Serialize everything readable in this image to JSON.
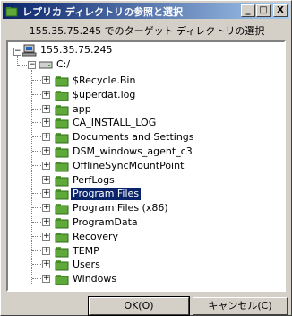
{
  "window": {
    "title": "レプリカ ディレクトリの参照と選択",
    "minimize_label": "_",
    "maximize_label": "□",
    "close_label": "X"
  },
  "subtitle": "155.35.75.245 でのターゲット ディレクトリの選択",
  "tree": {
    "host": "155.35.75.245",
    "drive": "C:/",
    "folders": [
      {
        "label": "$Recycle.Bin",
        "selected": false
      },
      {
        "label": "$uperdat.log",
        "selected": false
      },
      {
        "label": "app",
        "selected": false
      },
      {
        "label": "CA_INSTALL_LOG",
        "selected": false
      },
      {
        "label": "Documents and Settings",
        "selected": false
      },
      {
        "label": "DSM_windows_agent_c3",
        "selected": false
      },
      {
        "label": "OfflineSyncMountPoint",
        "selected": false
      },
      {
        "label": "PerfLogs",
        "selected": false
      },
      {
        "label": "Program Files",
        "selected": true
      },
      {
        "label": "Program Files (x86)",
        "selected": false
      },
      {
        "label": "ProgramData",
        "selected": false
      },
      {
        "label": "Recovery",
        "selected": false
      },
      {
        "label": "TEMP",
        "selected": false
      },
      {
        "label": "Users",
        "selected": false
      },
      {
        "label": "Windows",
        "selected": false
      }
    ]
  },
  "buttons": {
    "ok": "OK(O)",
    "cancel": "キャンセル(C)"
  },
  "colors": {
    "titlebar": "#0a246a",
    "folder": "#5fa83a",
    "selection": "#0a246a"
  }
}
